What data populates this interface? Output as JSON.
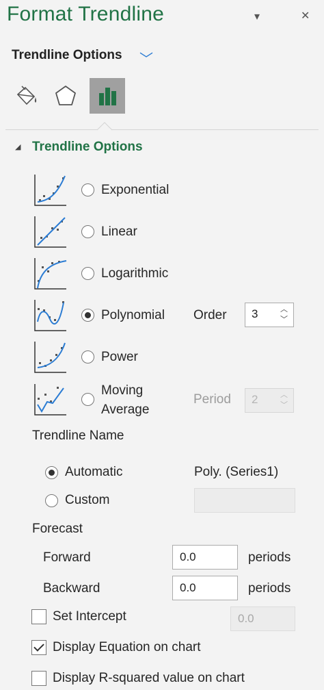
{
  "pane": {
    "title": "Format Trendline",
    "pin_label": "▾",
    "close_label": "✕",
    "options_dropdown_label": "Trendline Options",
    "options_dropdown_arrow": "﹀"
  },
  "tabs": [
    {
      "name": "fill-line",
      "icon": "paint-bucket-icon",
      "selected": false
    },
    {
      "name": "effects",
      "icon": "pentagon-icon",
      "selected": false
    },
    {
      "name": "trendline-options",
      "icon": "bar-chart-icon",
      "selected": true
    }
  ],
  "section": {
    "caret": "◢",
    "title": "Trendline Options"
  },
  "trend_types": [
    {
      "label": "Exponential",
      "selected": false
    },
    {
      "label": "Linear",
      "selected": false
    },
    {
      "label": "Logarithmic",
      "selected": false
    },
    {
      "label": "Polynomial",
      "selected": true
    },
    {
      "label": "Power",
      "selected": false
    },
    {
      "label": "Moving Average",
      "label_line1": "Moving",
      "label_line2": "Average",
      "selected": false
    }
  ],
  "order": {
    "label": "Order",
    "value": "3"
  },
  "period": {
    "label": "Period",
    "value": "2",
    "disabled": true
  },
  "trendline_name": {
    "heading": "Trendline Name",
    "automatic_label": "Automatic",
    "automatic_value": "Poly. (Series1)",
    "custom_label": "Custom",
    "custom_value": "",
    "selected": "automatic"
  },
  "forecast": {
    "heading": "Forecast",
    "forward_label": "Forward",
    "forward_value": "0.0",
    "backward_label": "Backward",
    "backward_value": "0.0",
    "unit": "periods"
  },
  "set_intercept": {
    "label": "Set Intercept",
    "value": "0.0",
    "checked": false
  },
  "display_equation": {
    "label": "Display Equation on chart",
    "checked": true
  },
  "display_r_squared": {
    "label": "Display R-squared value on chart",
    "checked": false
  },
  "colors": {
    "accent_green": "#217346",
    "accent_blue": "#2b7cd3",
    "icon_green": "#217346",
    "panel_bg": "#f3f3f3"
  }
}
